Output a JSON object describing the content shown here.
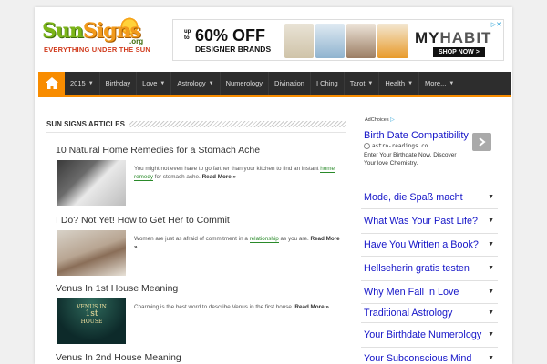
{
  "header": {
    "logo_sun": "Sun",
    "logo_signs": "Signs",
    "logo_org": ".org",
    "tagline": "EVERYTHING UNDER THE SUN"
  },
  "banner_ad": {
    "up_to": "up to",
    "percent": "60% OFF",
    "subtitle": "DESIGNER BRANDS",
    "brand_my": "MY",
    "brand_habit": "HABIT",
    "cta": "SHOP NOW >",
    "adchoice": "▷✕"
  },
  "nav": {
    "items": [
      {
        "label": "2015",
        "caret": true
      },
      {
        "label": "Birthday",
        "caret": false
      },
      {
        "label": "Love",
        "caret": true
      },
      {
        "label": "Astrology",
        "caret": true
      },
      {
        "label": "Numerology",
        "caret": false
      },
      {
        "label": "Divination",
        "caret": false
      },
      {
        "label": "I Ching",
        "caret": false
      },
      {
        "label": "Tarot",
        "caret": true
      },
      {
        "label": "Health",
        "caret": true
      },
      {
        "label": "More...",
        "caret": true
      }
    ]
  },
  "section": {
    "title": "SUN SIGNS ARTICLES"
  },
  "articles": [
    {
      "title": "10 Natural Home Remedies for a Stomach Ache",
      "pre": "You might not even have to go farther than your kitchen to find an instant ",
      "link": "home remedy",
      "post": " for stomach ache. ",
      "more": "Read More »"
    },
    {
      "title": "I Do? Not Yet! How to Get Her to Commit",
      "pre": "Women are just as afraid of commitment in a ",
      "link": "relationship",
      "post": " as you are. ",
      "more": "Read More »"
    },
    {
      "title": "Venus In 1st House Meaning",
      "pre": "Charming is the best word to describe Venus in the first house. ",
      "link": "",
      "post": "",
      "more": "Read More »",
      "thumb_line1": "VENUS IN",
      "thumb_line2": "1st",
      "thumb_line3": "HOUSE"
    },
    {
      "title": "Venus In 2nd House Meaning"
    }
  ],
  "sidebar": {
    "adchoices": "AdChoices",
    "first_ad": {
      "title": "Birth Date Compatibility",
      "url": "astro-readings.co",
      "desc": "Enter Your Birthdate Now. Discover Your love Chemistry."
    },
    "links": [
      "Mode, die Spaß macht",
      "What Was Your Past Life?",
      "Have You Written a Book?",
      "Hellseherin gratis testen",
      "Why Men Fall In Love",
      "Traditional Astrology",
      "Your Birthdate Numerology",
      "Your Subconscious Mind"
    ]
  },
  "colors": {
    "accent": "#f88c00",
    "nav_bg": "#2d2d2d",
    "ad_link": "#1515c8"
  }
}
